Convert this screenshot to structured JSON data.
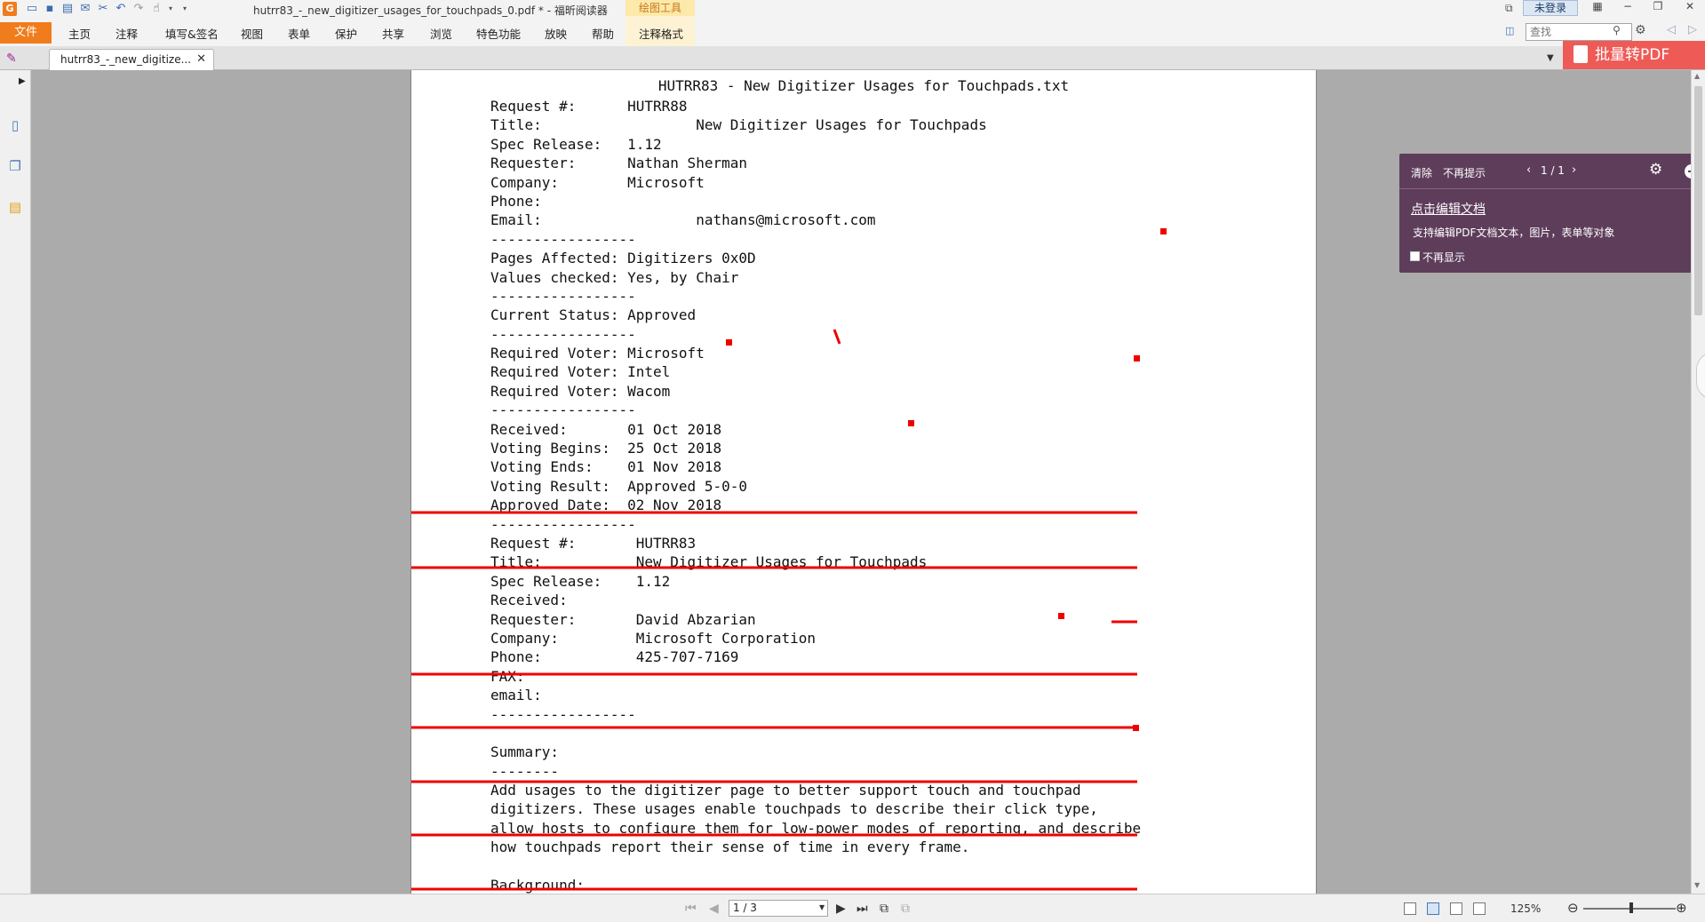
{
  "window": {
    "title": "hutrr83_-_new_digitizer_usages_for_touchpads_0.pdf * - 福昕阅读器",
    "context_tab": "绘图工具",
    "login_label": "未登录",
    "search_placeholder": "查找"
  },
  "menu": {
    "file": "文件",
    "items": [
      "主页",
      "注释",
      "填写&签名",
      "视图",
      "表单",
      "保护",
      "共享",
      "浏览",
      "特色功能",
      "放映",
      "帮助",
      "注释格式"
    ]
  },
  "tabs": {
    "doc_tab_label": "hutrr83_-_new_digitize...",
    "batch_pdf_label": "批量转PDF"
  },
  "document": {
    "heading": "HUTRR83 - New Digitizer Usages for Touchpads.txt",
    "lines": [
      "Request #:      HUTRR88",
      "Title:                  New Digitizer Usages for Touchpads",
      "Spec Release:   1.12",
      "Requester:      Nathan Sherman",
      "Company:        Microsoft",
      "Phone:",
      "Email:                  nathans@microsoft.com",
      "-----------------",
      "Pages Affected: Digitizers 0x0D",
      "Values checked: Yes, by Chair",
      "-----------------",
      "Current Status: Approved",
      "-----------------",
      "Required Voter: Microsoft",
      "Required Voter: Intel",
      "Required Voter: Wacom",
      "-----------------",
      "Received:       01 Oct 2018",
      "Voting Begins:  25 Oct 2018",
      "Voting Ends:    01 Nov 2018",
      "Voting Result:  Approved 5-0-0",
      "Approved Date:  02 Nov 2018",
      "-----------------",
      "Request #:       HUTRR83",
      "Title:           New Digitizer Usages for Touchpads",
      "Spec Release:    1.12",
      "Received:",
      "Requester:       David Abzarian",
      "Company:         Microsoft Corporation",
      "Phone:           425-707-7169",
      "FAX:",
      "email:",
      "-----------------",
      "",
      "Summary:",
      "--------",
      "Add usages to the digitizer page to better support touch and touchpad",
      "digitizers. These usages enable touchpads to describe their click type,",
      "allow hosts to configure them for low-power modes of reporting, and describe",
      "how touchpads report their sense of time in every frame.",
      "",
      "Background:"
    ],
    "annotation_color": "#ee0000"
  },
  "tip_panel": {
    "clear": "清除",
    "no_prompt": "不再提示",
    "page_indicator": "1 / 1",
    "link": "点击编辑文档",
    "description": "支持编辑PDF文档文本，图片，表单等对象",
    "dont_show": "不再显示"
  },
  "statusbar": {
    "page_value": "1 / 3",
    "zoom": "125%"
  },
  "colors": {
    "accent_orange": "#f07c1b",
    "panel_purple": "#5e3d5b",
    "batch_red": "#ee5b57"
  }
}
